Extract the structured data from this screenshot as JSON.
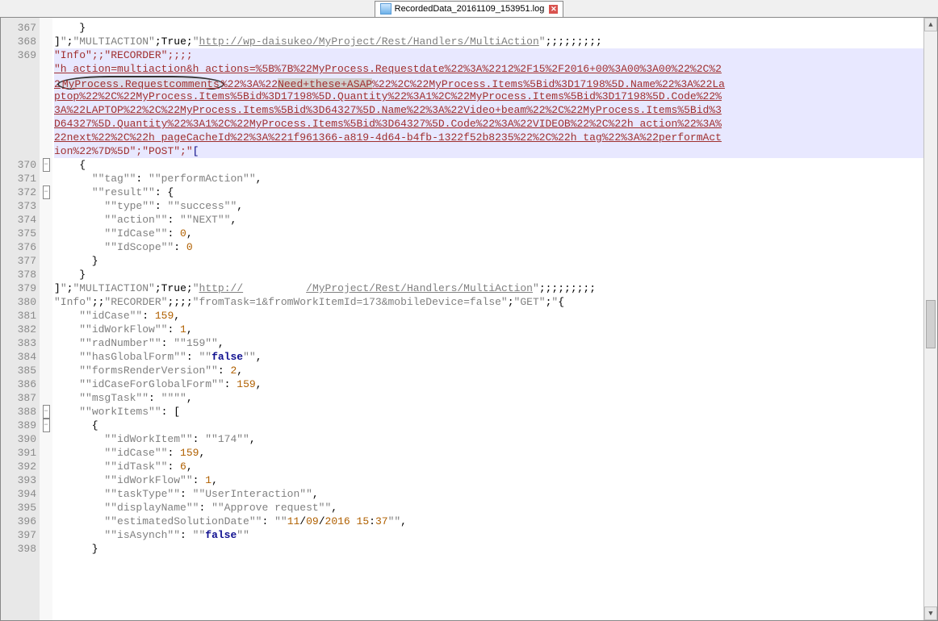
{
  "tab": {
    "title": "RecordedData_20161109_153951.log",
    "close_glyph": "✕"
  },
  "first_line_num": 367,
  "gutter_fold_rows": [
    3,
    5,
    21,
    22
  ],
  "code_lines": [
    {
      "n": 367,
      "spans": [
        {
          "t": "    }",
          "c": ""
        }
      ]
    },
    {
      "n": 368,
      "spans": [
        {
          "t": "]",
          "c": ""
        },
        {
          "t": "\"",
          "c": "s-gray"
        },
        {
          "t": ";",
          "c": ""
        },
        {
          "t": "\"MULTIACTION\"",
          "c": "s-gray"
        },
        {
          "t": ";",
          "c": ""
        },
        {
          "t": "True",
          "c": ""
        },
        {
          "t": ";",
          "c": ""
        },
        {
          "t": "\"",
          "c": "s-gray"
        },
        {
          "t": "http://wp-daisukeo/MyProject/Rest/Handlers/MultiAction",
          "c": "s-gray s-link"
        },
        {
          "t": "\"",
          "c": "s-gray"
        },
        {
          "t": ";;;;;;;;;",
          "c": ""
        }
      ]
    },
    {
      "n": 369,
      "wrap": true,
      "rows": [
        [
          {
            "t": "\"Info\"",
            "c": "s-red"
          },
          {
            "t": ";;",
            "c": "s-red"
          },
          {
            "t": "\"RECORDER\"",
            "c": "s-red"
          },
          {
            "t": ";;;;",
            "c": "s-red"
          }
        ],
        [
          {
            "t": "\"h_action=multiaction&h_actions=%5B%7B%22MyProcess.Requestdate%22%3A%2212%2F15%2F2016+00%3A00%3A00%22%2C%2",
            "c": "s-red s-link"
          }
        ],
        [
          {
            "t": "2",
            "c": "s-red s-link"
          },
          {
            "t": "MyProcess.Requestcomments",
            "c": "s-red s-link",
            "hl": "circle"
          },
          {
            "t": "%22%3A%22",
            "c": "s-red s-link"
          },
          {
            "t": "Need+these+ASAP",
            "c": "s-red s-link",
            "hl": "block"
          },
          {
            "t": "%22%2C%22MyProcess.Items%5Bid%3D17198%5D.Name%22%3A%22La",
            "c": "s-red s-link"
          }
        ],
        [
          {
            "t": "ptop%22%2C%22MyProcess.Items%5Bid%3D17198%5D.Quantity%22%3A1%2C%22MyProcess.Items%5Bid%3D17198%5D.Code%22%",
            "c": "s-red s-link"
          }
        ],
        [
          {
            "t": "3A%22LAPTOP%22%2C%22MyProcess.Items%5Bid%3D64327%5D.Name%22%3A%22Video+beam%22%2C%22MyProcess.Items%5Bid%3",
            "c": "s-red s-link"
          }
        ],
        [
          {
            "t": "D64327%5D.Quantity%22%3A1%2C%22MyProcess.Items%5Bid%3D64327%5D.Code%22%3A%22VIDEOB%22%2C%22h_action%22%3A%",
            "c": "s-red s-link"
          }
        ],
        [
          {
            "t": "22next%22%2C%22h_pageCacheId%22%3A%221f961366-a819-4d64-b4fb-1322f52b8235%22%2C%22h_tag%22%3A%22performAct",
            "c": "s-red s-link"
          }
        ],
        [
          {
            "t": "ion%22%7D%5D\"",
            "c": "s-red"
          },
          {
            "t": ";",
            "c": "s-red"
          },
          {
            "t": "\"POST\"",
            "c": "s-red"
          },
          {
            "t": ";",
            "c": "s-red"
          },
          {
            "t": "\"",
            "c": "s-red"
          },
          {
            "t": "[",
            "c": "s-op"
          }
        ]
      ]
    },
    {
      "n": 370,
      "spans": [
        {
          "t": "    {",
          "c": ""
        }
      ]
    },
    {
      "n": 371,
      "spans": [
        {
          "t": "      ",
          "c": ""
        },
        {
          "t": "\"\"tag\"\"",
          "c": "s-gray"
        },
        {
          "t": ": ",
          "c": ""
        },
        {
          "t": "\"\"performAction\"\"",
          "c": "s-gray"
        },
        {
          "t": ",",
          "c": ""
        }
      ]
    },
    {
      "n": 372,
      "spans": [
        {
          "t": "      ",
          "c": ""
        },
        {
          "t": "\"\"result\"\"",
          "c": "s-gray"
        },
        {
          "t": ": {",
          "c": ""
        }
      ]
    },
    {
      "n": 373,
      "spans": [
        {
          "t": "        ",
          "c": ""
        },
        {
          "t": "\"\"type\"\"",
          "c": "s-gray"
        },
        {
          "t": ": ",
          "c": ""
        },
        {
          "t": "\"\"success\"\"",
          "c": "s-gray"
        },
        {
          "t": ",",
          "c": ""
        }
      ]
    },
    {
      "n": 374,
      "spans": [
        {
          "t": "        ",
          "c": ""
        },
        {
          "t": "\"\"action\"\"",
          "c": "s-gray"
        },
        {
          "t": ": ",
          "c": ""
        },
        {
          "t": "\"\"NEXT\"\"",
          "c": "s-gray"
        },
        {
          "t": ",",
          "c": ""
        }
      ]
    },
    {
      "n": 375,
      "spans": [
        {
          "t": "        ",
          "c": ""
        },
        {
          "t": "\"\"IdCase\"\"",
          "c": "s-gray"
        },
        {
          "t": ": ",
          "c": ""
        },
        {
          "t": "0",
          "c": "s-num"
        },
        {
          "t": ",",
          "c": ""
        }
      ]
    },
    {
      "n": 376,
      "spans": [
        {
          "t": "        ",
          "c": ""
        },
        {
          "t": "\"\"IdScope\"\"",
          "c": "s-gray"
        },
        {
          "t": ": ",
          "c": ""
        },
        {
          "t": "0",
          "c": "s-num"
        }
      ]
    },
    {
      "n": 377,
      "spans": [
        {
          "t": "      }",
          "c": ""
        }
      ]
    },
    {
      "n": 378,
      "spans": [
        {
          "t": "    }",
          "c": ""
        }
      ]
    },
    {
      "n": 379,
      "spans": [
        {
          "t": "]",
          "c": ""
        },
        {
          "t": "\"",
          "c": "s-gray"
        },
        {
          "t": ";",
          "c": ""
        },
        {
          "t": "\"MULTIACTION\"",
          "c": "s-gray"
        },
        {
          "t": ";",
          "c": ""
        },
        {
          "t": "True",
          "c": ""
        },
        {
          "t": ";",
          "c": ""
        },
        {
          "t": "\"",
          "c": "s-gray"
        },
        {
          "t": "http://",
          "c": "s-gray s-link"
        },
        {
          "t": "          ",
          "c": "s-gray"
        },
        {
          "t": "/MyProject/Rest/Handlers/MultiAction",
          "c": "s-gray s-link"
        },
        {
          "t": "\"",
          "c": "s-gray"
        },
        {
          "t": ";;;;;;;;;",
          "c": ""
        }
      ]
    },
    {
      "n": 380,
      "spans": [
        {
          "t": "\"Info\"",
          "c": "s-gray"
        },
        {
          "t": ";;",
          "c": ""
        },
        {
          "t": "\"RECORDER\"",
          "c": "s-gray"
        },
        {
          "t": ";;;;",
          "c": ""
        },
        {
          "t": "\"fromTask=1&fromWorkItemId=173&mobileDevice=false\"",
          "c": "s-gray"
        },
        {
          "t": ";",
          "c": ""
        },
        {
          "t": "\"GET\"",
          "c": "s-gray"
        },
        {
          "t": ";",
          "c": ""
        },
        {
          "t": "\"",
          "c": "s-gray"
        },
        {
          "t": "{",
          "c": ""
        }
      ]
    },
    {
      "n": 381,
      "spans": [
        {
          "t": "    ",
          "c": ""
        },
        {
          "t": "\"\"idCase\"\"",
          "c": "s-gray"
        },
        {
          "t": ": ",
          "c": ""
        },
        {
          "t": "159",
          "c": "s-num"
        },
        {
          "t": ",",
          "c": ""
        }
      ]
    },
    {
      "n": 382,
      "spans": [
        {
          "t": "    ",
          "c": ""
        },
        {
          "t": "\"\"idWorkFlow\"\"",
          "c": "s-gray"
        },
        {
          "t": ": ",
          "c": ""
        },
        {
          "t": "1",
          "c": "s-num"
        },
        {
          "t": ",",
          "c": ""
        }
      ]
    },
    {
      "n": 383,
      "spans": [
        {
          "t": "    ",
          "c": ""
        },
        {
          "t": "\"\"radNumber\"\"",
          "c": "s-gray"
        },
        {
          "t": ": ",
          "c": ""
        },
        {
          "t": "\"\"159\"\"",
          "c": "s-gray"
        },
        {
          "t": ",",
          "c": ""
        }
      ]
    },
    {
      "n": 384,
      "spans": [
        {
          "t": "    ",
          "c": ""
        },
        {
          "t": "\"\"hasGlobalForm\"\"",
          "c": "s-gray"
        },
        {
          "t": ": ",
          "c": ""
        },
        {
          "t": "\"\"",
          "c": "s-gray"
        },
        {
          "t": "false",
          "c": "s-blue"
        },
        {
          "t": "\"\"",
          "c": "s-gray"
        },
        {
          "t": ",",
          "c": ""
        }
      ]
    },
    {
      "n": 385,
      "spans": [
        {
          "t": "    ",
          "c": ""
        },
        {
          "t": "\"\"formsRenderVersion\"\"",
          "c": "s-gray"
        },
        {
          "t": ": ",
          "c": ""
        },
        {
          "t": "2",
          "c": "s-num"
        },
        {
          "t": ",",
          "c": ""
        }
      ]
    },
    {
      "n": 386,
      "spans": [
        {
          "t": "    ",
          "c": ""
        },
        {
          "t": "\"\"idCaseForGlobalForm\"\"",
          "c": "s-gray"
        },
        {
          "t": ": ",
          "c": ""
        },
        {
          "t": "159",
          "c": "s-num"
        },
        {
          "t": ",",
          "c": ""
        }
      ]
    },
    {
      "n": 387,
      "spans": [
        {
          "t": "    ",
          "c": ""
        },
        {
          "t": "\"\"msgTask\"\"",
          "c": "s-gray"
        },
        {
          "t": ": ",
          "c": ""
        },
        {
          "t": "\"\"\"\"",
          "c": "s-gray"
        },
        {
          "t": ",",
          "c": ""
        }
      ]
    },
    {
      "n": 388,
      "spans": [
        {
          "t": "    ",
          "c": ""
        },
        {
          "t": "\"\"workItems\"\"",
          "c": "s-gray"
        },
        {
          "t": ": [",
          "c": ""
        }
      ]
    },
    {
      "n": 389,
      "spans": [
        {
          "t": "      {",
          "c": ""
        }
      ]
    },
    {
      "n": 390,
      "spans": [
        {
          "t": "        ",
          "c": ""
        },
        {
          "t": "\"\"idWorkItem\"\"",
          "c": "s-gray"
        },
        {
          "t": ": ",
          "c": ""
        },
        {
          "t": "\"\"174\"\"",
          "c": "s-gray"
        },
        {
          "t": ",",
          "c": ""
        }
      ]
    },
    {
      "n": 391,
      "spans": [
        {
          "t": "        ",
          "c": ""
        },
        {
          "t": "\"\"idCase\"\"",
          "c": "s-gray"
        },
        {
          "t": ": ",
          "c": ""
        },
        {
          "t": "159",
          "c": "s-num"
        },
        {
          "t": ",",
          "c": ""
        }
      ]
    },
    {
      "n": 392,
      "spans": [
        {
          "t": "        ",
          "c": ""
        },
        {
          "t": "\"\"idTask\"\"",
          "c": "s-gray"
        },
        {
          "t": ": ",
          "c": ""
        },
        {
          "t": "6",
          "c": "s-num"
        },
        {
          "t": ",",
          "c": ""
        }
      ]
    },
    {
      "n": 393,
      "spans": [
        {
          "t": "        ",
          "c": ""
        },
        {
          "t": "\"\"idWorkFlow\"\"",
          "c": "s-gray"
        },
        {
          "t": ": ",
          "c": ""
        },
        {
          "t": "1",
          "c": "s-num"
        },
        {
          "t": ",",
          "c": ""
        }
      ]
    },
    {
      "n": 394,
      "spans": [
        {
          "t": "        ",
          "c": ""
        },
        {
          "t": "\"\"taskType\"\"",
          "c": "s-gray"
        },
        {
          "t": ": ",
          "c": ""
        },
        {
          "t": "\"\"UserInteraction\"\"",
          "c": "s-gray"
        },
        {
          "t": ",",
          "c": ""
        }
      ]
    },
    {
      "n": 395,
      "spans": [
        {
          "t": "        ",
          "c": ""
        },
        {
          "t": "\"\"displayName\"\"",
          "c": "s-gray"
        },
        {
          "t": ": ",
          "c": ""
        },
        {
          "t": "\"\"Approve request\"\"",
          "c": "s-gray"
        },
        {
          "t": ",",
          "c": ""
        }
      ]
    },
    {
      "n": 396,
      "spans": [
        {
          "t": "        ",
          "c": ""
        },
        {
          "t": "\"\"estimatedSolutionDate\"\"",
          "c": "s-gray"
        },
        {
          "t": ": ",
          "c": ""
        },
        {
          "t": "\"\"",
          "c": "s-gray"
        },
        {
          "t": "11",
          "c": "s-num"
        },
        {
          "t": "/",
          "c": ""
        },
        {
          "t": "09",
          "c": "s-num"
        },
        {
          "t": "/",
          "c": ""
        },
        {
          "t": "2016 15",
          "c": "s-num"
        },
        {
          "t": ":",
          "c": ""
        },
        {
          "t": "37",
          "c": "s-num"
        },
        {
          "t": "\"\"",
          "c": "s-gray"
        },
        {
          "t": ",",
          "c": ""
        }
      ]
    },
    {
      "n": 397,
      "spans": [
        {
          "t": "        ",
          "c": ""
        },
        {
          "t": "\"\"isAsynch\"\"",
          "c": "s-gray"
        },
        {
          "t": ": ",
          "c": ""
        },
        {
          "t": "\"\"",
          "c": "s-gray"
        },
        {
          "t": "false",
          "c": "s-blue"
        },
        {
          "t": "\"\"",
          "c": "s-gray"
        }
      ]
    },
    {
      "n": 398,
      "spans": [
        {
          "t": "      }",
          "c": ""
        }
      ]
    }
  ]
}
